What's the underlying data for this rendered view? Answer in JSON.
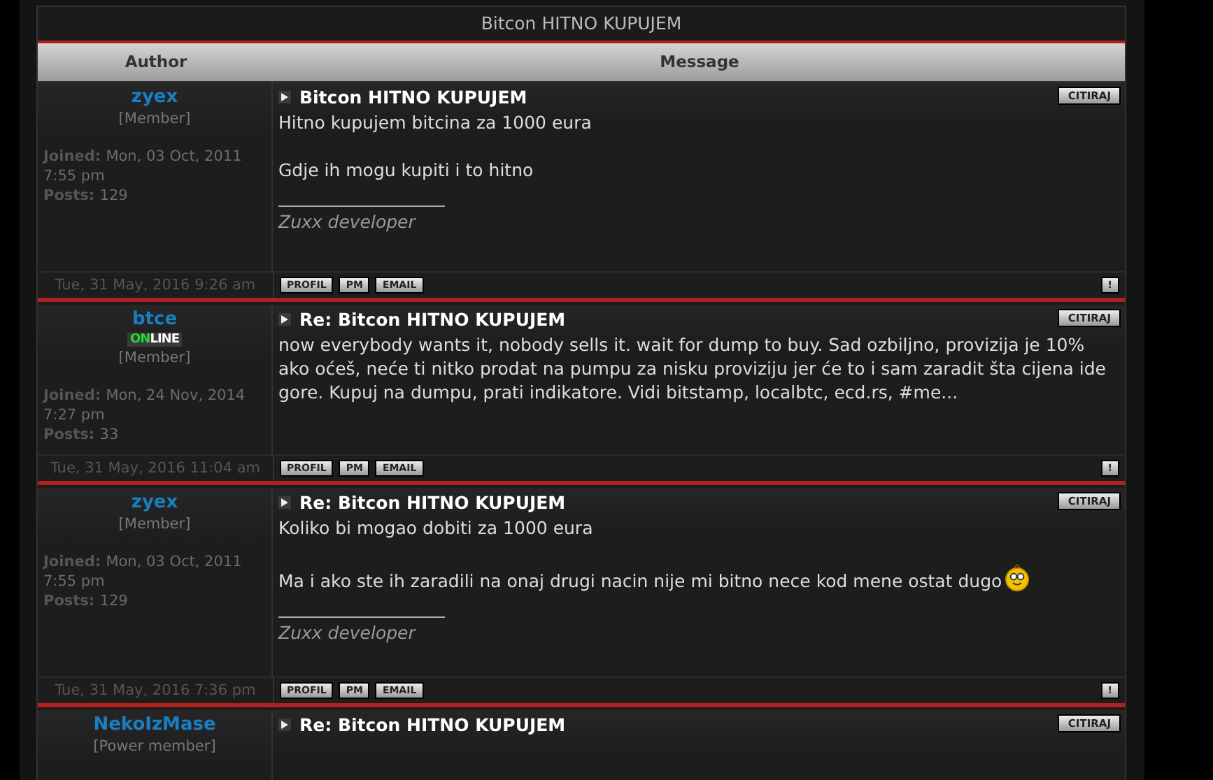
{
  "topic_title": "Bitcon HITNO KUPUJEM",
  "columns": [
    "Author",
    "Message"
  ],
  "posts": [
    {
      "author": "zyex",
      "online": false,
      "rank": "[Member]",
      "joined_label": "Joined:",
      "joined": "Mon, 03 Oct, 2011 7:55 pm",
      "posts_label": "Posts:",
      "posts": "129",
      "date": "Tue, 31 May, 2016 9:26 am",
      "title": "Bitcon HITNO KUPUJEM",
      "quote": "CITIRAJ",
      "paragraphs": [
        "Hitno kupujem bitcina za 1000 eura",
        "Gdje ih mogu kupiti i to hitno"
      ],
      "emoticon": false,
      "signature": "Zuxx developer",
      "buttons": [
        "PROFIL",
        "PM",
        "EMAIL"
      ],
      "report": "!"
    },
    {
      "author": "btce",
      "online": true,
      "online_on": "ON",
      "online_line": "LINE",
      "rank": "[Member]",
      "joined_label": "Joined:",
      "joined": "Mon, 24 Nov, 2014 7:27 pm",
      "posts_label": "Posts:",
      "posts": "33",
      "date": "Tue, 31 May, 2016 11:04 am",
      "title": "Re: Bitcon HITNO KUPUJEM",
      "quote": "CITIRAJ",
      "paragraphs": [
        "now everybody wants it, nobody sells it. wait for dump to buy. Sad ozbiljno, provizija je 10% ako oćeš, neće ti nitko prodat na pumpu za nisku proviziju jer će to i sam zaradit šta cijena ide gore. Kupuj na dumpu, prati indikatore. Vidi bitstamp, localbtc, ecd.rs, #me..."
      ],
      "emoticon": false,
      "buttons": [
        "PROFIL",
        "PM",
        "EMAIL"
      ],
      "report": "!"
    },
    {
      "author": "zyex",
      "online": false,
      "rank": "[Member]",
      "joined_label": "Joined:",
      "joined": "Mon, 03 Oct, 2011 7:55 pm",
      "posts_label": "Posts:",
      "posts": "129",
      "date": "Tue, 31 May, 2016 7:36 pm",
      "title": "Re: Bitcon HITNO KUPUJEM",
      "quote": "CITIRAJ",
      "paragraphs": [
        "Koliko bi mogao dobiti za 1000 eura",
        "Ma i ako ste ih zaradili na onaj drugi nacin nije mi bitno nece kod mene ostat dugo"
      ],
      "emoticon": true,
      "signature": "Zuxx developer",
      "buttons": [
        "PROFIL",
        "PM",
        "EMAIL"
      ],
      "report": "!"
    },
    {
      "author": "NekoIzMase",
      "online": false,
      "rank": "[Power member]",
      "title": "Re: Bitcon HITNO KUPUJEM",
      "quote": "CITIRAJ"
    }
  ]
}
